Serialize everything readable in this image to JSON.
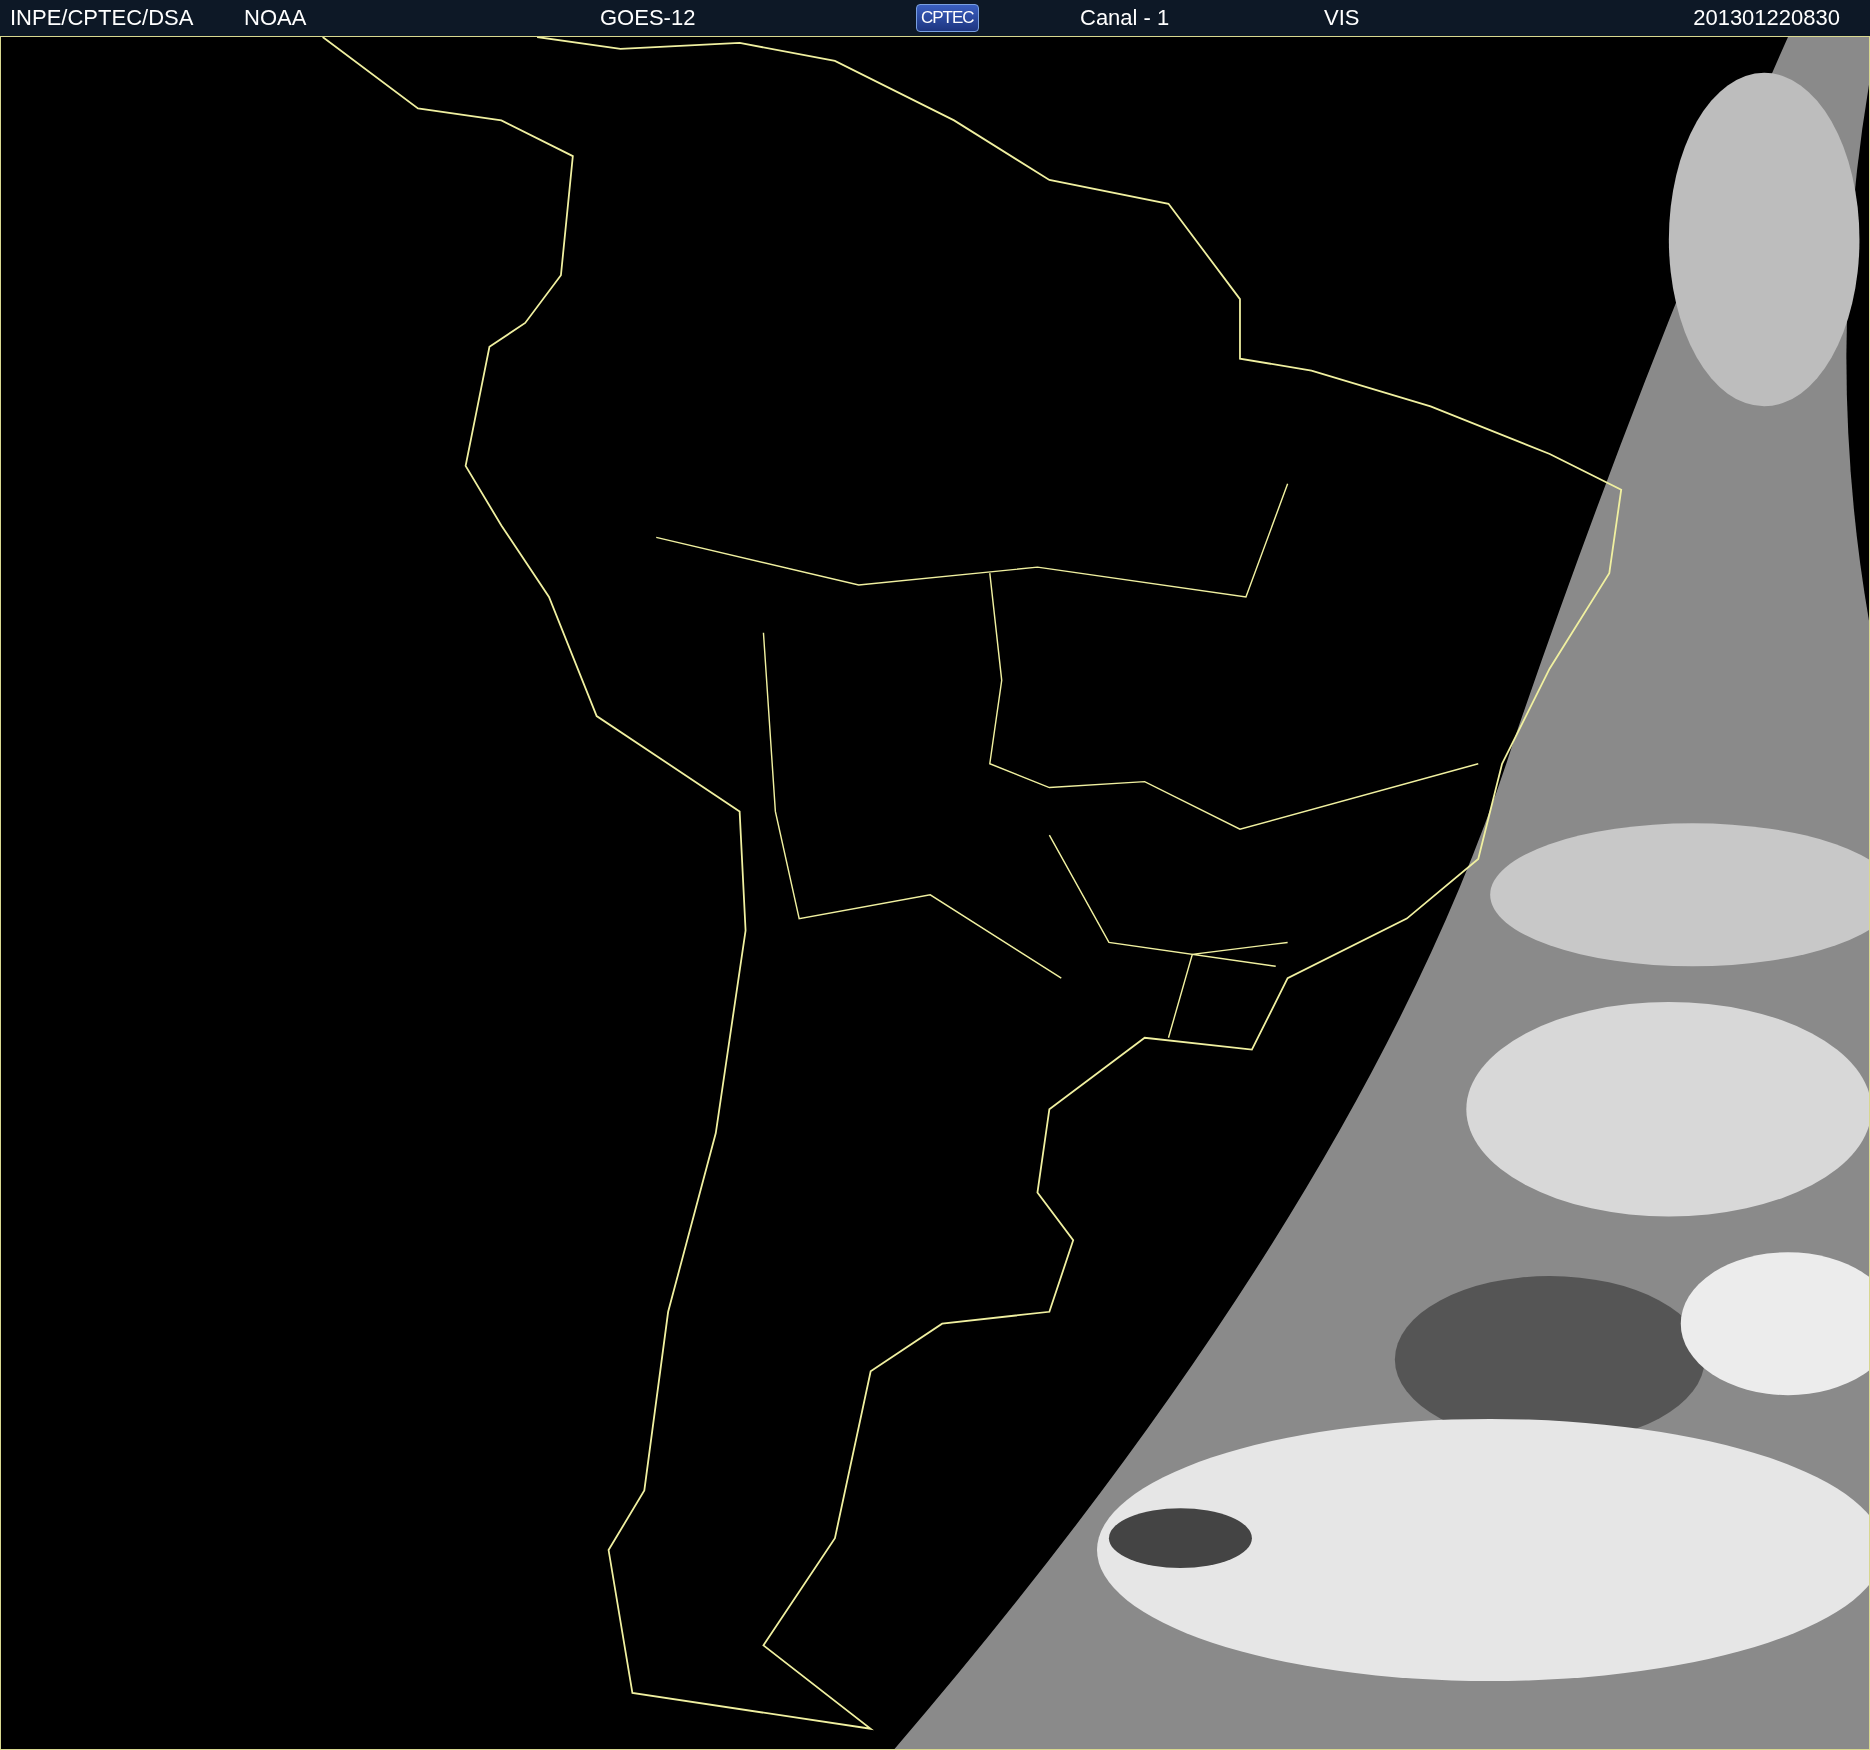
{
  "header": {
    "source": "INPE/CPTEC/DSA",
    "agency": "NOAA",
    "satellite": "GOES-12",
    "logo": "CPTEC",
    "channel": "Canal - 1",
    "band": "VIS",
    "timestamp": "201301220830"
  }
}
